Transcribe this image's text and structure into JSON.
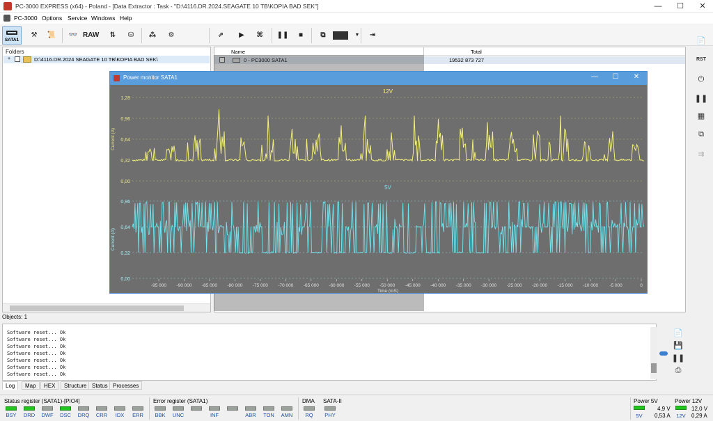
{
  "window": {
    "title": "PC-3000 EXPRESS (x64) - Poland - [Data Extractor : Task - \"D:\\4116.DR.2024.SEAGATE 10 TB\\KOPIA BAD SEK\"]",
    "min": "—",
    "max": "☐",
    "close": "✕"
  },
  "menu": [
    "PC-3000",
    "Options",
    "Service",
    "Windows",
    "Help"
  ],
  "toolbar": {
    "sata_label": "SATA1",
    "raw_label": "RAW"
  },
  "folders": {
    "header": "Folders",
    "path": "D:\\4116.DR.2024 SEAGATE 10 TB\\KOPIA BAD SEK\\"
  },
  "filelist": {
    "col_name": "Name",
    "col_total": "Total",
    "row_name": "0 - PC3000 SATA1",
    "row_total": "19532 873 727"
  },
  "objects": "Objects: 1",
  "log": {
    "lines": [
      "Software reset... Ok",
      "Software reset... Ok",
      "Software reset... Ok",
      "Software reset... Ok",
      "Software reset... Ok",
      "Software reset... Ok",
      "Software reset... Ok"
    ],
    "tabs": [
      "Log",
      "Map",
      "HEX",
      "Structure",
      "Status",
      "Processes"
    ]
  },
  "status": {
    "status_title": "Status register (SATA1)-[PIO4]",
    "status_leds": [
      {
        "label": "BSY",
        "on": true
      },
      {
        "label": "DRD",
        "on": true
      },
      {
        "label": "DWF",
        "on": false
      },
      {
        "label": "DSC",
        "on": true
      },
      {
        "label": "DRQ",
        "on": false
      },
      {
        "label": "CRR",
        "on": false
      },
      {
        "label": "IDX",
        "on": false
      },
      {
        "label": "ERR",
        "on": false
      }
    ],
    "error_title": "Error register (SATA1)",
    "error_leds": [
      {
        "label": "BBK",
        "on": false
      },
      {
        "label": "UNC",
        "on": false
      },
      {
        "label": "",
        "on": false
      },
      {
        "label": "INF",
        "on": false
      },
      {
        "label": "",
        "on": false
      },
      {
        "label": "ABR",
        "on": false
      },
      {
        "label": "TON",
        "on": false
      },
      {
        "label": "AMN",
        "on": false
      }
    ],
    "dma_title": "DMA",
    "dma_led": "RQ",
    "sata2_title": "SATA-II",
    "sata2_led": "PHY",
    "power5_title": "Power 5V",
    "power5_label": "5V",
    "power5_v": "4,9 V",
    "power5_a": "0,53 A",
    "power12_title": "Power 12V",
    "power12_label": "12V",
    "power12_v": "12,0 V",
    "power12_a": "0,29 A"
  },
  "power_monitor": {
    "title": "Power monitor SATA1",
    "chart_data": [
      {
        "type": "line",
        "title": "12V",
        "ylabel": "Current (A)",
        "ylim": [
          0,
          1.28
        ],
        "yticks": [
          "1,28",
          "0,96",
          "0,64",
          "0,32",
          "0,00"
        ],
        "series": [
          {
            "color": "#f5f07a",
            "baseline": 0.32,
            "description_bursts": [
              0.45,
              0.55,
              0.7,
              1.1,
              0.9,
              1.0,
              0.8,
              0.9,
              0.85,
              1.0,
              0.9,
              1.0,
              0.95,
              1.0,
              0.9,
              0.75,
              0.95,
              1.0,
              0.6,
              1.1,
              0.55
            ]
          }
        ]
      },
      {
        "type": "line",
        "title": "5V",
        "ylabel": "Current (A)",
        "ylim": [
          0,
          0.96
        ],
        "yticks": [
          "0,96",
          "0,64",
          "0,32",
          "0,00"
        ],
        "series": [
          {
            "color": "#6fe6f0",
            "baseline": 0.64,
            "low": 0.32,
            "high": 0.96
          }
        ],
        "xlabel": "Time (mS)",
        "xticks": [
          "-95 000",
          "-90 000",
          "-85 000",
          "-80 000",
          "-75 000",
          "-70 000",
          "-65 000",
          "-60 000",
          "-55 000",
          "-50 000",
          "-45 000",
          "-40 000",
          "-35 000",
          "-30 000",
          "-25 000",
          "-20 000",
          "-15 000",
          "-10 000",
          "-5 000",
          "0"
        ]
      }
    ]
  }
}
